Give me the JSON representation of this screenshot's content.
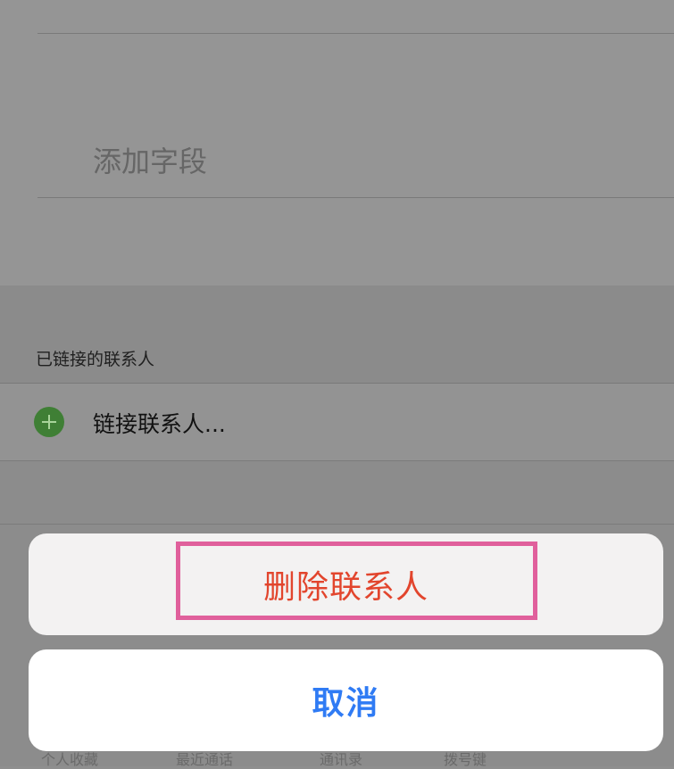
{
  "fields": {
    "add_field_label": "添加字段"
  },
  "linked_contacts": {
    "section_header": "已链接的联系人",
    "link_label": "链接联系人..."
  },
  "tab_bar": {
    "items": [
      "个人收藏",
      "最近通话",
      "通讯录",
      "拨号键"
    ]
  },
  "action_sheet": {
    "delete_label": "删除联系人",
    "cancel_label": "取消"
  },
  "colors": {
    "delete": "#e2452d",
    "cancel": "#2f7bf4",
    "highlight": "#e0609c",
    "plus_icon": "#3f7f35"
  }
}
